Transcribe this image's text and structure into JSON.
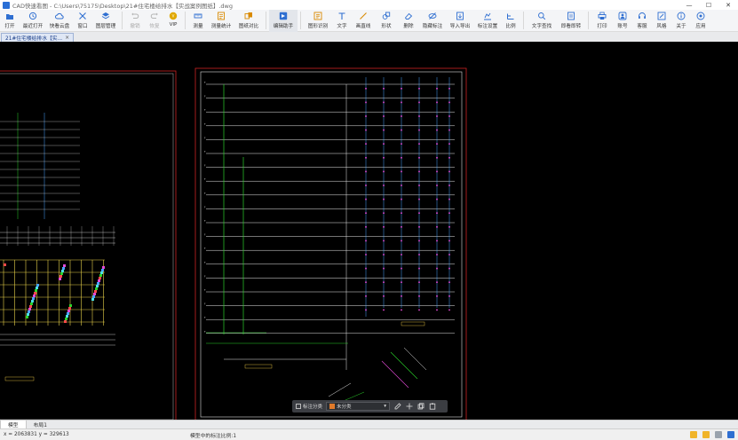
{
  "window": {
    "title": "CAD快速看图 - C:\\Users\\75175\\Desktop\\21#住宅楼给排水【实战案例图纸】.dwg",
    "controls": [
      "—",
      "☐",
      "✕"
    ]
  },
  "toolbar": {
    "items": [
      {
        "label": "打开",
        "icon": "folder-icon",
        "color": "#2f6fd1"
      },
      {
        "label": "最近打开",
        "icon": "history-icon",
        "color": "#2f6fd1"
      },
      {
        "label": "快看云盘",
        "icon": "cloud-icon",
        "color": "#2f6fd1"
      },
      {
        "label": "窗口",
        "icon": "window-icon",
        "color": "#2f6fd1"
      },
      {
        "label": "图层管理",
        "icon": "layers-icon",
        "color": "#2f6fd1"
      },
      {
        "label": "撤销",
        "icon": "undo-icon",
        "color": "#b5b5b5",
        "disabled": true
      },
      {
        "label": "恢复",
        "icon": "redo-icon",
        "color": "#b5b5b5",
        "disabled": true
      },
      {
        "label": "VIP",
        "icon": "vip-icon",
        "color": "#e0a800"
      },
      {
        "label": "测量",
        "icon": "measure-icon",
        "color": "#2f6fd1"
      },
      {
        "label": "测量统计",
        "icon": "measure-stats-icon",
        "color": "#d98a00"
      },
      {
        "label": "图纸对比",
        "icon": "compare-icon",
        "color": "#d98a00"
      },
      {
        "label": "编辑助手",
        "icon": "edit-assistant-icon",
        "color": "#2f6fd1",
        "active": true
      },
      {
        "label": "图形识别",
        "icon": "shape-recognize-icon",
        "color": "#d98a00"
      },
      {
        "label": "文字",
        "icon": "text-icon",
        "color": "#2f6fd1"
      },
      {
        "label": "画直线",
        "icon": "line-icon",
        "color": "#d98a00"
      },
      {
        "label": "形状",
        "icon": "shape-icon",
        "color": "#2f6fd1"
      },
      {
        "label": "删除",
        "icon": "eraser-icon",
        "color": "#2f6fd1"
      },
      {
        "label": "隐藏标注",
        "icon": "hide-icon",
        "color": "#2f6fd1"
      },
      {
        "label": "导入导出",
        "icon": "import-export-icon",
        "color": "#2f6fd1"
      },
      {
        "label": "标注设置",
        "icon": "annotation-settings-icon",
        "color": "#2f6fd1"
      },
      {
        "label": "比例",
        "icon": "scale-icon",
        "color": "#2f6fd1"
      },
      {
        "label": "文字查找",
        "icon": "text-search-icon",
        "color": "#2f6fd1"
      },
      {
        "label": "即看即转",
        "icon": "convert-icon",
        "color": "#2f6fd1"
      },
      {
        "label": "打印",
        "icon": "print-icon",
        "color": "#2f6fd1"
      },
      {
        "label": "账号",
        "icon": "account-icon",
        "color": "#2f6fd1"
      },
      {
        "label": "客服",
        "icon": "support-icon",
        "color": "#2f6fd1"
      },
      {
        "label": "风格",
        "icon": "style-icon",
        "color": "#2f6fd1"
      },
      {
        "label": "关于",
        "icon": "info-icon",
        "color": "#2f6fd1"
      },
      {
        "label": "应用",
        "icon": "apps-icon",
        "color": "#2f6fd1"
      }
    ]
  },
  "doc_tab": {
    "label": "21#住宅楼给排水【实...",
    "close": "×"
  },
  "floatbar": {
    "item1": "标注分类",
    "selected": "未分类",
    "caret": "▾"
  },
  "layout_tabs": [
    "模型",
    "布局1"
  ],
  "status": {
    "coords": "x = 2063831  y = 329613",
    "scale_text": "模型中的标注比例:1"
  }
}
